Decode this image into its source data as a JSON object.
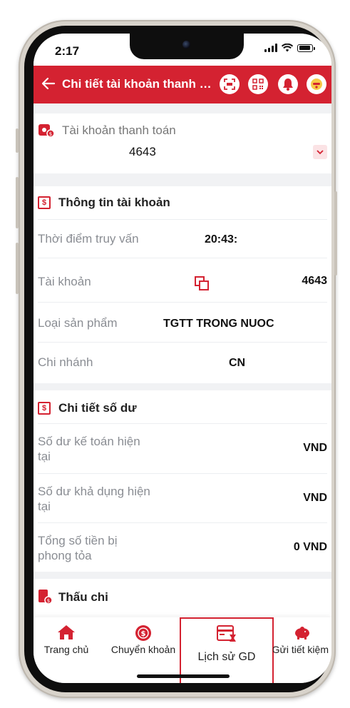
{
  "status_bar": {
    "time": "2:17"
  },
  "header": {
    "title": "Chi tiết tài khoản thanh to...",
    "icons": [
      "back-arrow-icon",
      "scan-icon",
      "qr-code-icon",
      "bell-icon",
      "avatar-icon"
    ]
  },
  "account_selector": {
    "label": "Tài khoản thanh toán",
    "account_number": "4643",
    "icon": "wallet-icon"
  },
  "account_info": {
    "title": "Thông tin tài khoản",
    "rows": [
      {
        "label": "Thời điểm truy vấn",
        "value": "20:43:"
      },
      {
        "label": "Tài khoản",
        "value": "4643"
      },
      {
        "label": "Loại sản phẩm",
        "value": "TGTT TRONG NUOC"
      },
      {
        "label": "Chi nhánh",
        "value": "CN"
      }
    ]
  },
  "balance_detail": {
    "title": "Chi tiết số dư",
    "rows": [
      {
        "label": "Số dư kế toán hiện tại",
        "value": "VND"
      },
      {
        "label": "Số dư khả dụng hiện tại",
        "value": "VND"
      },
      {
        "label": "Tổng số tiền bị phong tỏa",
        "value": "0 VND"
      }
    ]
  },
  "overdraft": {
    "title": "Thấu chi"
  },
  "bottom_nav": [
    {
      "label": "Trang chủ",
      "icon": "home-icon"
    },
    {
      "label": "Chuyển khoản",
      "icon": "money-transfer-icon"
    },
    {
      "label": "Lịch sử GD",
      "icon": "transaction-history-icon"
    },
    {
      "label": "Gửi tiết kiệm",
      "icon": "piggy-bank-icon"
    }
  ],
  "colors": {
    "brand": "#d42231",
    "background": "#f1f2f4"
  }
}
